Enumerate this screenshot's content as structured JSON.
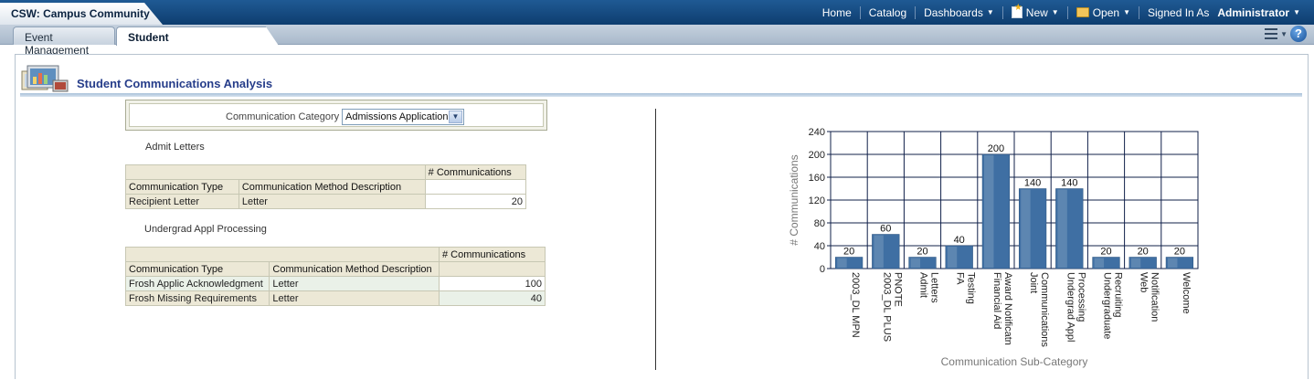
{
  "app": {
    "title": "CSW: Campus Community"
  },
  "global_nav": {
    "home": "Home",
    "catalog": "Catalog",
    "dashboards": "Dashboards",
    "new": "New",
    "open": "Open",
    "signed_in_as": "Signed In As",
    "user": "Administrator"
  },
  "tabs": [
    {
      "label": "Event Management"
    },
    {
      "label": "Student Communications"
    }
  ],
  "section": {
    "title": "Student Communications Analysis"
  },
  "prompt": {
    "label": "Communication Category",
    "value": "Admissions Application"
  },
  "groups": [
    {
      "title": "Admit Letters",
      "measure_header": "# Communications",
      "col_headers": [
        "Communication Type",
        "Communication Method Description"
      ],
      "rows": [
        {
          "type": "Recipient Letter",
          "method": "Letter",
          "value": "20"
        }
      ]
    },
    {
      "title": "Undergrad Appl Processing",
      "measure_header": "# Communications",
      "col_headers": [
        "Communication Type",
        "Communication Method Description"
      ],
      "rows": [
        {
          "type": "Frosh Applic Acknowledgment",
          "method": "Letter",
          "value": "100"
        },
        {
          "type": "Frosh Missing Requirements",
          "method": "Letter",
          "value": "40"
        }
      ]
    }
  ],
  "chart_data": {
    "type": "bar",
    "xlabel": "Communication Sub-Category",
    "ylabel": "# Communications",
    "ylim": [
      0,
      240
    ],
    "yticks": [
      0,
      40,
      80,
      120,
      160,
      200,
      240
    ],
    "grid": true,
    "bar_color": "#3f6fa3",
    "categories": [
      "2003_DL MPN",
      "2003_DL PLUS PNOTE",
      "Admit Letters",
      "FA Testing",
      "Financial Aid Award Notificatn",
      "Joint Communications",
      "Undergrad Appl Processing",
      "Undergraduate Recruiting",
      "Web Notification",
      "Welcome"
    ],
    "category_lines": [
      [
        "2003_DL MPN"
      ],
      [
        "2003_DL PLUS",
        "PNOTE"
      ],
      [
        "Admit",
        "Letters"
      ],
      [
        "FA",
        "Testing"
      ],
      [
        "Financial Aid",
        "Award Notificatn"
      ],
      [
        "Joint",
        "Communications"
      ],
      [
        "Undergrad Appl",
        "Processing"
      ],
      [
        "Undergraduate",
        "Recruiting"
      ],
      [
        "Web",
        "Notification"
      ],
      [
        "Welcome"
      ]
    ],
    "values": [
      20,
      60,
      20,
      40,
      200,
      140,
      140,
      20,
      20,
      20
    ]
  }
}
